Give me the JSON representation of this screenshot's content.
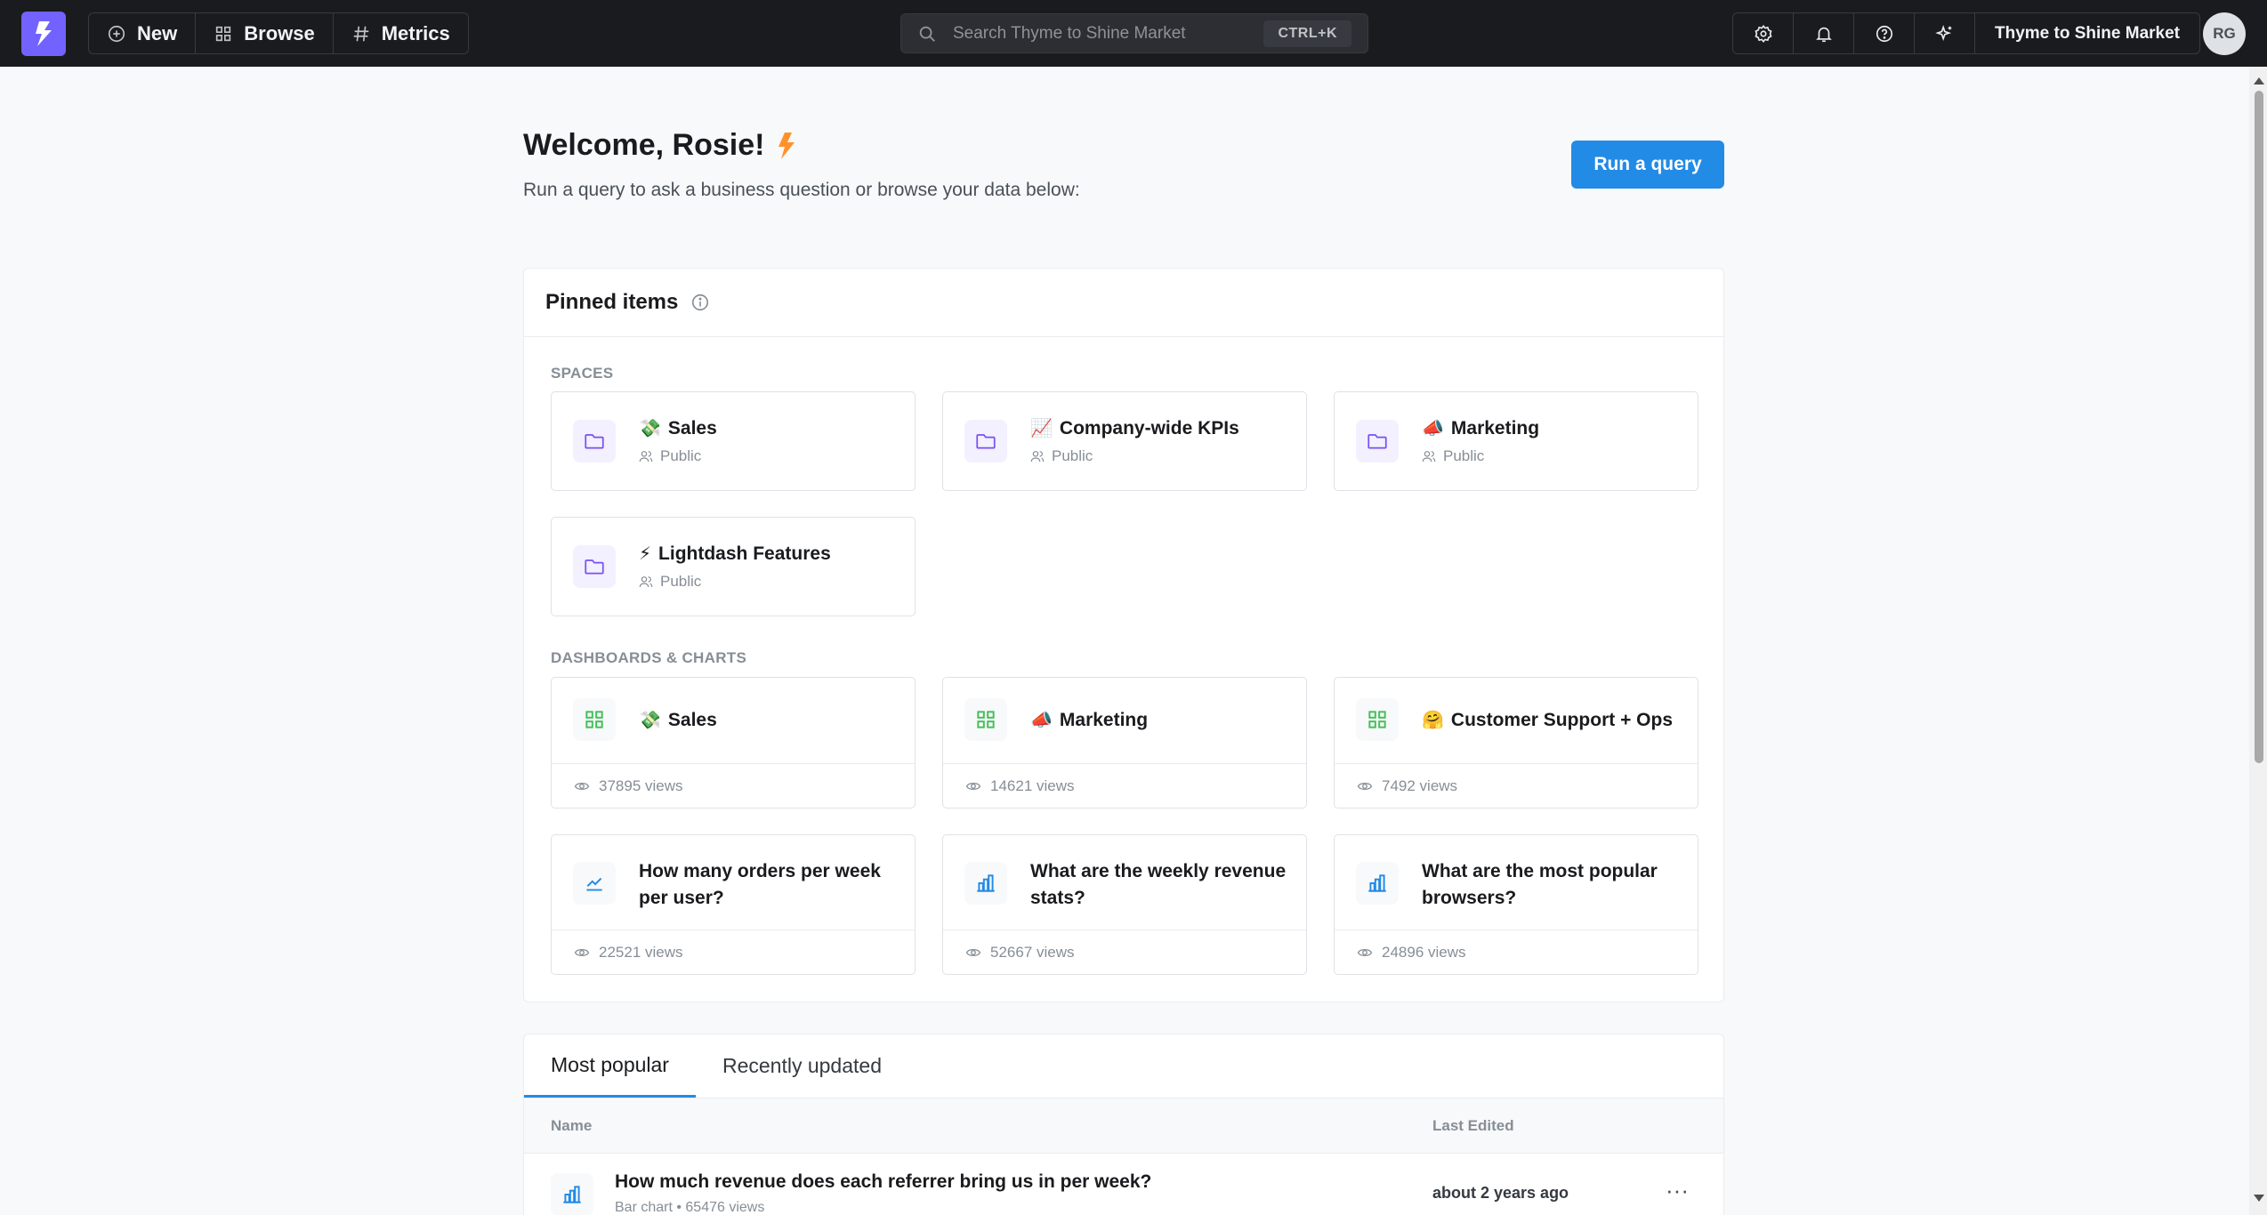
{
  "navbar": {
    "new_label": "New",
    "browse_label": "Browse",
    "metrics_label": "Metrics",
    "search_placeholder": "Search Thyme to Shine Market",
    "search_shortcut": "CTRL+K",
    "org_name": "Thyme to Shine Market",
    "avatar_initials": "RG"
  },
  "header": {
    "welcome": "Welcome, Rosie!",
    "subtitle": "Run a query to ask a business question or browse your data below:",
    "run_query_label": "Run a query"
  },
  "pinned": {
    "title": "Pinned items",
    "spaces_label": "SPACES",
    "spaces": [
      {
        "emoji": "💸",
        "name": "Sales",
        "visibility": "Public"
      },
      {
        "emoji": "📈",
        "name": "Company-wide KPIs",
        "visibility": "Public"
      },
      {
        "emoji": "📣",
        "name": "Marketing",
        "visibility": "Public"
      },
      {
        "emoji": "⚡",
        "name": "Lightdash Features",
        "visibility": "Public"
      }
    ],
    "dashboards_label": "DASHBOARDS & CHARTS",
    "dashboards": [
      {
        "emoji": "💸",
        "name": "Sales",
        "views": "37895 views"
      },
      {
        "emoji": "📣",
        "name": "Marketing",
        "views": "14621 views"
      },
      {
        "emoji": "🤗",
        "name": "Customer Support + Ops",
        "views": "7492 views"
      }
    ],
    "charts": [
      {
        "name_line1": "How many orders per week",
        "name_line2": "per user?",
        "views": "22521 views",
        "icon": "line-chart-icon"
      },
      {
        "name_line1": "What are the weekly revenue",
        "name_line2": "stats?",
        "views": "52667 views",
        "icon": "bar-chart-icon"
      },
      {
        "name_line1": "What are the most popular",
        "name_line2": "browsers?",
        "views": "24896 views",
        "icon": "bar-chart-icon"
      }
    ]
  },
  "tabs": {
    "items": [
      "Most popular",
      "Recently updated"
    ],
    "columns": {
      "name": "Name",
      "last_edited": "Last Edited"
    },
    "rows": [
      {
        "title": "How much revenue does each referrer bring us in per week?",
        "meta": "Bar chart • 65476 views",
        "last_edited": "about 2 years ago",
        "menu": "···"
      }
    ]
  },
  "colors": {
    "navbar_bg": "#1a1b1e",
    "logo_bg": "#7262ff",
    "primary_blue": "#228be6",
    "space_icon_purple": "#7950f2",
    "dashboard_icon_green": "#40c057",
    "chart_icon_blue": "#228be6"
  }
}
